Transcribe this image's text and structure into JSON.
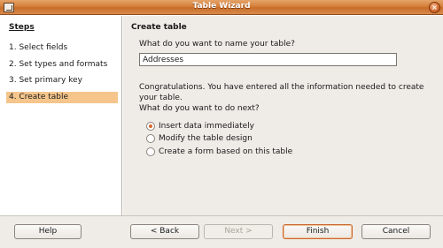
{
  "window": {
    "title": "Table Wizard",
    "close_glyph": "×"
  },
  "steps": {
    "heading": "Steps",
    "items": [
      {
        "label": "1. Select fields"
      },
      {
        "label": "2. Set types and formats"
      },
      {
        "label": "3. Set primary key"
      },
      {
        "label": "4. Create table",
        "active": true
      }
    ]
  },
  "main": {
    "heading": "Create table",
    "name_prompt": "What do you want to name your table?",
    "table_name": "Addresses",
    "congrats": "Congratulations. You have entered all the information needed to create your table.",
    "next_prompt": "What do you want to do next?",
    "options": [
      {
        "label": "Insert data immediately",
        "checked": true
      },
      {
        "label": "Modify the table design",
        "checked": false
      },
      {
        "label": "Create a form based on this table",
        "checked": false
      }
    ]
  },
  "buttons": {
    "help": "Help",
    "back": "< Back",
    "next": "Next >",
    "finish": "Finish",
    "cancel": "Cancel"
  },
  "colors": {
    "titlebar": "#d57f3a",
    "active_step": "#f5c58c",
    "radio_dot": "#d4692c"
  }
}
